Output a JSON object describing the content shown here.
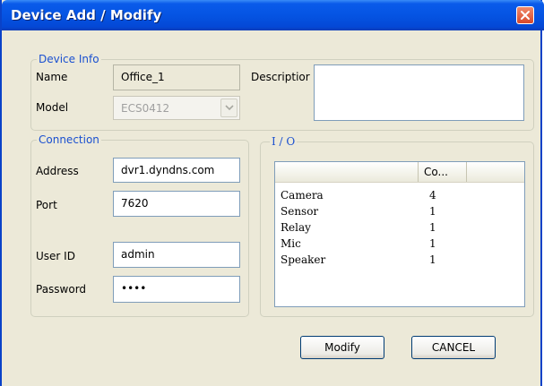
{
  "window": {
    "title": "Device Add / Modify"
  },
  "device_info": {
    "legend": "Device Info",
    "name_label": "Name",
    "name_value": "Office_1",
    "model_label": "Model",
    "model_value": "ECS0412",
    "description_label": "Descriptior",
    "description_value": ""
  },
  "connection": {
    "legend": "Connection",
    "address_label": "Address",
    "address_value": "dvr1.dyndns.com",
    "port_label": "Port",
    "port_value": "7620",
    "userid_label": "User ID",
    "userid_value": "admin",
    "password_label": "Password",
    "password_value": "••••"
  },
  "io": {
    "legend": "I / O",
    "columns": [
      "",
      "Co..."
    ],
    "rows": [
      {
        "name": "Camera",
        "count": "4"
      },
      {
        "name": "Sensor",
        "count": "1"
      },
      {
        "name": "Relay",
        "count": "1"
      },
      {
        "name": "Mic",
        "count": "1"
      },
      {
        "name": "Speaker",
        "count": "1"
      }
    ]
  },
  "buttons": {
    "modify": "Modify",
    "cancel": "CANCEL"
  },
  "icons": {
    "close": "close-icon",
    "dropdown": "chevron-down-icon"
  }
}
